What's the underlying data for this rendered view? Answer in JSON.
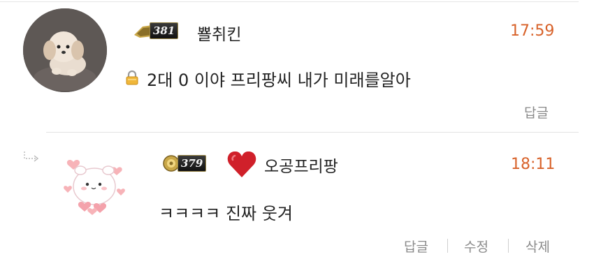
{
  "comments": [
    {
      "level": "381",
      "nickname": "뾸취킨",
      "time": "17:59",
      "text": "2대 0 이야 프리팡씨 내가 미래를알아",
      "actions": {
        "reply": "답글"
      }
    },
    {
      "level": "379",
      "nickname": "오공프리팡",
      "time": "18:11",
      "text": "ㅋㅋㅋㅋ 진짜 웃겨",
      "actions": {
        "reply": "답글",
        "edit": "수정",
        "delete": "삭제"
      }
    }
  ],
  "colors": {
    "time": "#d8622a",
    "action": "#8a8a8a",
    "heart": "#d0202a"
  },
  "icons": {
    "comment1_avatar": "puppy-avatar",
    "comment1_badge": "level-badge-icon",
    "comment1_lock": "lock-icon",
    "comment2_avatar": "cute-character-avatar",
    "comment2_badge": "level-badge-icon",
    "comment2_heart": "heart-icon",
    "reply_marker": "reply-arrow-icon"
  }
}
